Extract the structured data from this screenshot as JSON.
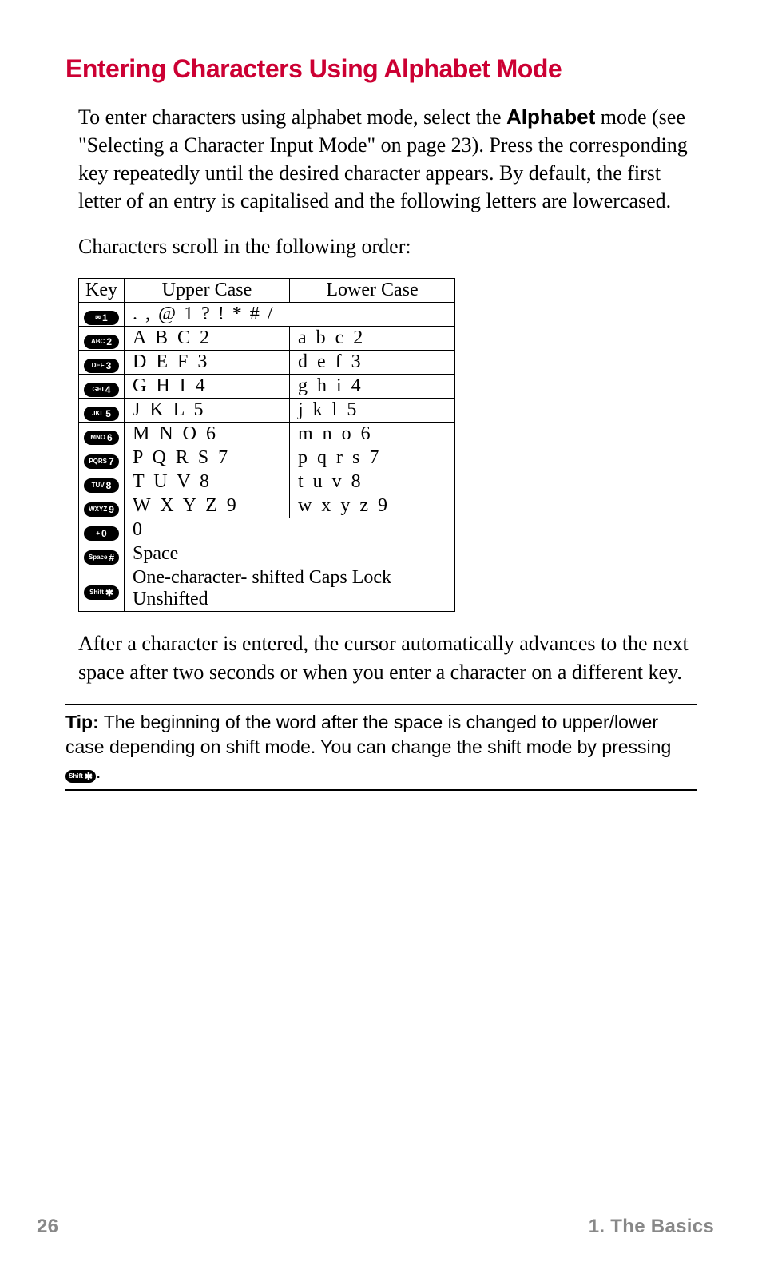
{
  "heading": "Entering Characters Using Alphabet Mode",
  "intro": {
    "pre": "To enter characters using alphabet mode, select the ",
    "bold": "Alphabet",
    "post": " mode (see \"Selecting a Character Input Mode\" on page 23). Press the corresponding key repeatedly until the desired character appears. By default, the first letter of an entry is capitalised and the following letters are lowercased."
  },
  "scroll_intro": "Characters scroll in the following order:",
  "table": {
    "headers": {
      "key": "Key",
      "upper": "Upper Case",
      "lower": "Lower Case"
    },
    "rows": [
      {
        "key_sub": "✉",
        "key_num": "1",
        "full": ". , @ 1 ? ! * # /"
      },
      {
        "key_sub": "ABC",
        "key_num": "2",
        "upper": "A B C 2",
        "lower": "a b c 2"
      },
      {
        "key_sub": "DEF",
        "key_num": "3",
        "upper": "D E F 3",
        "lower": "d e f 3"
      },
      {
        "key_sub": "GHI",
        "key_num": "4",
        "upper": "G H I 4",
        "lower": "g h i 4"
      },
      {
        "key_sub": "JKL",
        "key_num": "5",
        "upper": "J K L 5",
        "lower": "j k l 5"
      },
      {
        "key_sub": "MNO",
        "key_num": "6",
        "upper": "M N O 6",
        "lower": "m n o 6"
      },
      {
        "key_sub": "PQRS",
        "key_num": "7",
        "upper": "P Q R S 7",
        "lower": "p q r s 7"
      },
      {
        "key_sub": "TUV",
        "key_num": "8",
        "upper": "T U V 8",
        "lower": "t u v 8"
      },
      {
        "key_sub": "WXYZ",
        "key_num": "9",
        "upper": "W X Y Z 9",
        "lower": "w x y z 9"
      },
      {
        "key_sub": "+",
        "key_num": "0",
        "full": "0"
      },
      {
        "key_sub": "Space",
        "key_num": "#",
        "full": "Space"
      },
      {
        "key_sub": "Shift",
        "key_num": "✱",
        "full": "One-character- shifted  Caps Lock  Unshifted"
      }
    ]
  },
  "after_para": "After a character is entered, the cursor automatically advances to the next space after two seconds or when you enter a character on a different key.",
  "tip": {
    "label": "Tip:",
    "pre": " The beginning of the word after the space is changed to upper/lower case depending on shift mode. You can change the shift mode by pressing ",
    "key_sub": "Shift",
    "key_num": "✱",
    "post": "."
  },
  "footer": {
    "page": "26",
    "section": "1. The Basics"
  }
}
